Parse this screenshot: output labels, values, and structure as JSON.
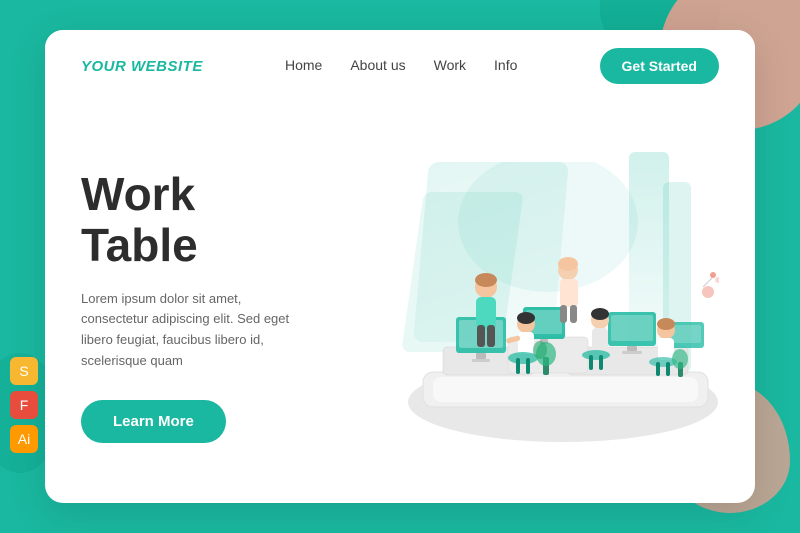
{
  "page": {
    "background_color": "#1ab8a0",
    "accent_color": "#1ab8a0"
  },
  "navbar": {
    "logo": "YOUR WEBSITE",
    "logo_your": "YOUR",
    "logo_website": "WEBSITE",
    "links": [
      {
        "label": "Home",
        "href": "#"
      },
      {
        "label": "About us",
        "href": "#"
      },
      {
        "label": "Work",
        "href": "#"
      },
      {
        "label": "Info",
        "href": "#"
      }
    ],
    "cta_label": "Get Started"
  },
  "hero": {
    "title_line1": "Work",
    "title_line2": "Table",
    "description": "Lorem ipsum dolor sit amet, consectetur adipiscing elit. Sed eget libero feugiat, faucibus libero id, scelerisque quam",
    "cta_label": "Learn More"
  },
  "tools": [
    {
      "name": "Sketch",
      "symbol": "S"
    },
    {
      "name": "Figma",
      "symbol": "F"
    },
    {
      "name": "Illustrator",
      "symbol": "Ai"
    }
  ]
}
